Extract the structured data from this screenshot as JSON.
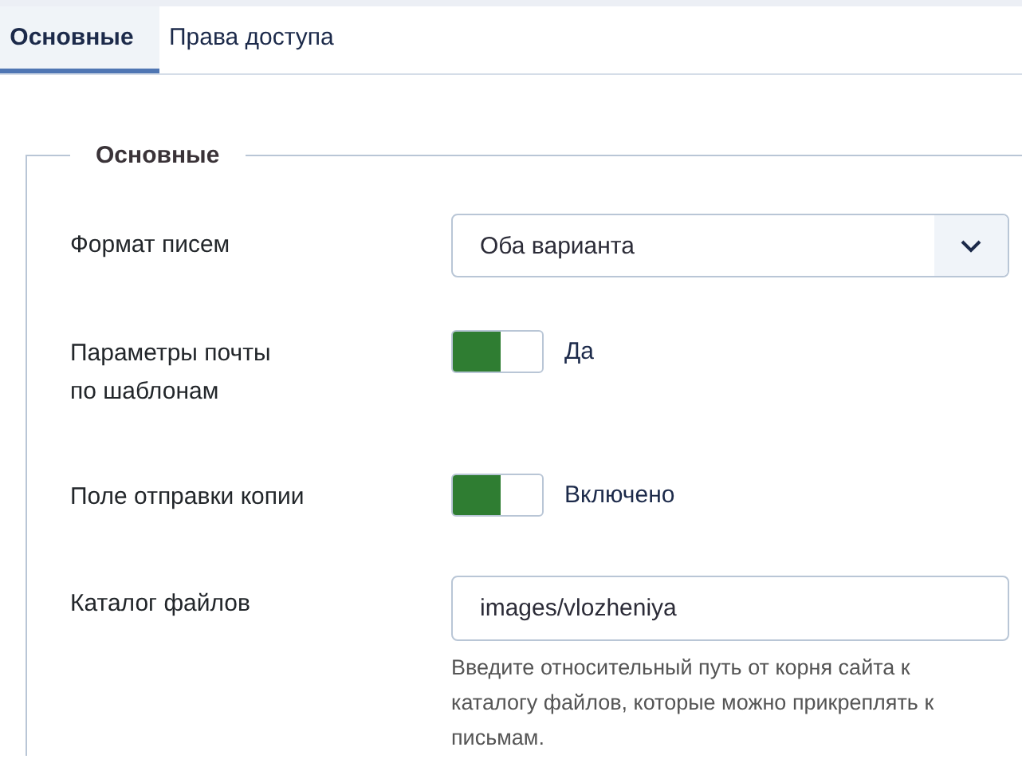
{
  "tabs": [
    {
      "label": "Основные",
      "selected": true
    },
    {
      "label": "Права доступа",
      "selected": false
    }
  ],
  "fieldset": {
    "legend": "Основные",
    "fields": [
      {
        "kind": "select",
        "label": "Формат писем",
        "value": "Оба варианта"
      },
      {
        "kind": "switch",
        "label": "Параметры почты\nпо шаблонам",
        "on": true,
        "state_text": "Да"
      },
      {
        "kind": "switch",
        "label": "Поле отправки копии",
        "on": true,
        "state_text": "Включено"
      },
      {
        "kind": "text",
        "label": "Каталог файлов",
        "value": "images/vlozheniya",
        "help": "Введите относительный путь от корня сайта к каталогу файлов, которые можно прикреплять к письмам."
      }
    ]
  }
}
